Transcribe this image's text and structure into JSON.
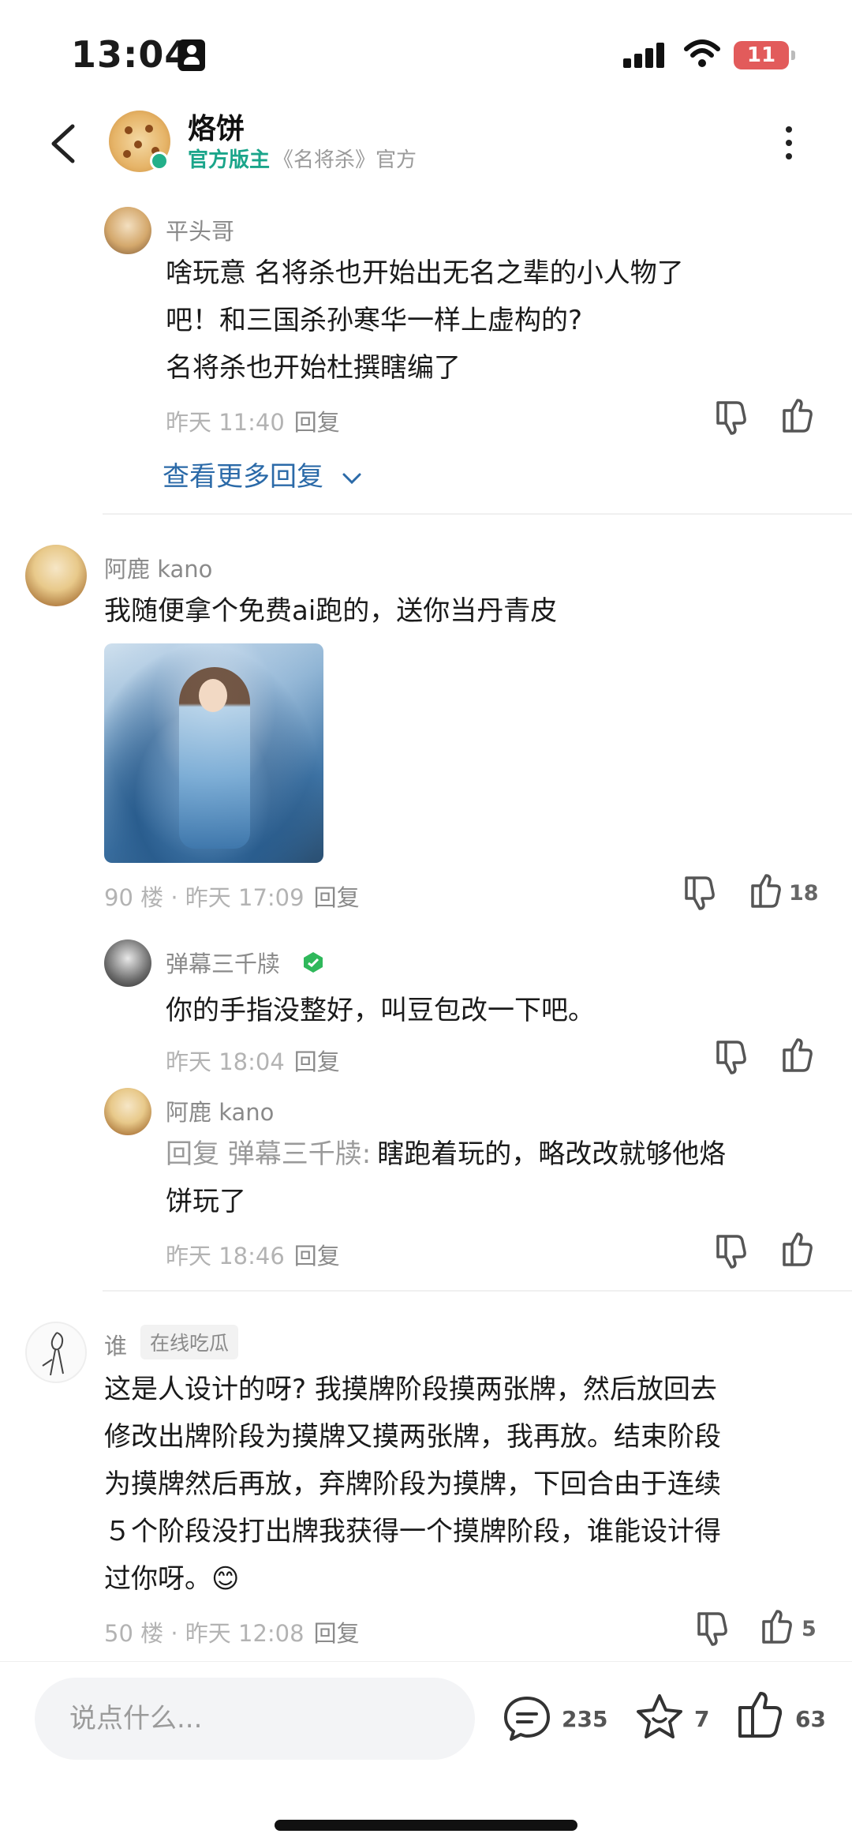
{
  "status": {
    "time": "13:04",
    "battery": "11"
  },
  "header": {
    "title": "烙饼",
    "role": "官方版主",
    "subtitle": "《名将杀》官方"
  },
  "comments": [
    {
      "name": "平头哥",
      "text_lines": [
        "啥玩意  名将杀也开始出无名之辈的小人物了",
        "吧！和三国杀孙寒华一样上虚构的?",
        "名将杀也开始杜撰瞎编了"
      ],
      "time": "昨天 11:40",
      "reply": "回复"
    },
    {
      "more_replies": "查看更多回复"
    },
    {
      "name": "阿鹿 kano",
      "text": "我随便拿个免费ai跑的，送你当丹青皮",
      "floor": "90 楼 · 昨天 17:09",
      "reply": "回复",
      "likes": "18"
    },
    {
      "name": "弹幕三千牍",
      "text": "你的手指没整好，叫豆包改一下吧。",
      "time": "昨天 18:04",
      "reply": "回复"
    },
    {
      "name": "阿鹿 kano",
      "reply_prefix": "回复 弹幕三千牍:",
      "text_line1": "瞎跑着玩的，略改改就够他烙",
      "text_line2": "饼玩了",
      "time": "昨天 18:46",
      "reply": "回复"
    },
    {
      "name": "谁",
      "tag": "在线吃瓜",
      "text_lines": [
        "这是人设计的呀? 我摸牌阶段摸两张牌，然后放回去",
        "修改出牌阶段为摸牌又摸两张牌，我再放。结束阶段",
        "为摸牌然后再放，弃牌阶段为摸牌，下回合由于连续",
        "５个阶段没打出牌我获得一个摸牌阶段，谁能设计得",
        "过你呀。😊"
      ],
      "floor": "50 楼 · 昨天 12:08",
      "reply": "回复",
      "likes": "5"
    }
  ],
  "bottom": {
    "placeholder": "说点什么...",
    "comment_count": "235",
    "star_count": "7",
    "like_count": "63"
  },
  "colors": {
    "accent": "#1aa58a",
    "link": "#2b6aa8"
  }
}
